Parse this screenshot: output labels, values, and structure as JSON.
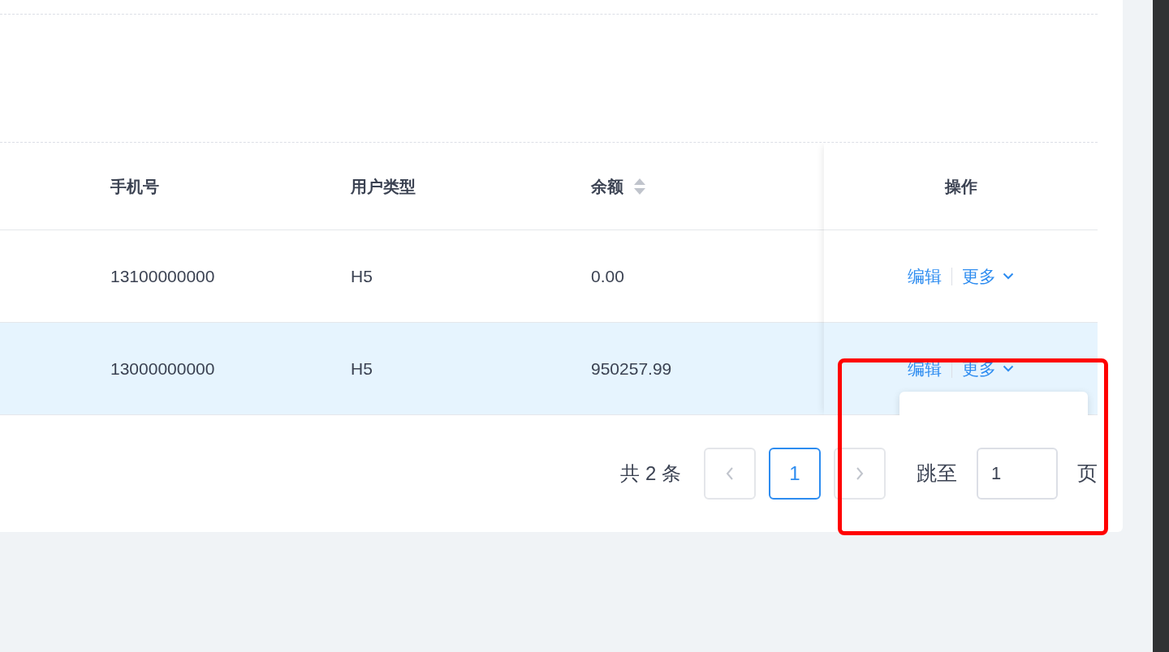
{
  "table": {
    "columns": [
      {
        "label": "手机号",
        "sortable": false
      },
      {
        "label": "用户类型",
        "sortable": false
      },
      {
        "label": "余额",
        "sortable": true
      }
    ],
    "action_column": "操作",
    "rows": [
      {
        "cells": [
          "13100000000",
          "H5",
          "0.00"
        ],
        "highlighted": false,
        "edit": "编辑",
        "more": "更多",
        "menu_open": false
      },
      {
        "cells": [
          "13000000000",
          "H5",
          "950257.99"
        ],
        "highlighted": true,
        "edit": "编辑",
        "more": "更多",
        "menu_open": true
      }
    ]
  },
  "pagination": {
    "total": "共 2 条",
    "prev_disabled": true,
    "next_disabled": true,
    "pages": [
      {
        "label": "1",
        "selected": true
      }
    ],
    "jump_label": "跳至",
    "jump_value": "1",
    "jump_suffix": "页"
  },
  "annotation": {
    "kind": "highlight_frame",
    "color": "#ff0000"
  }
}
